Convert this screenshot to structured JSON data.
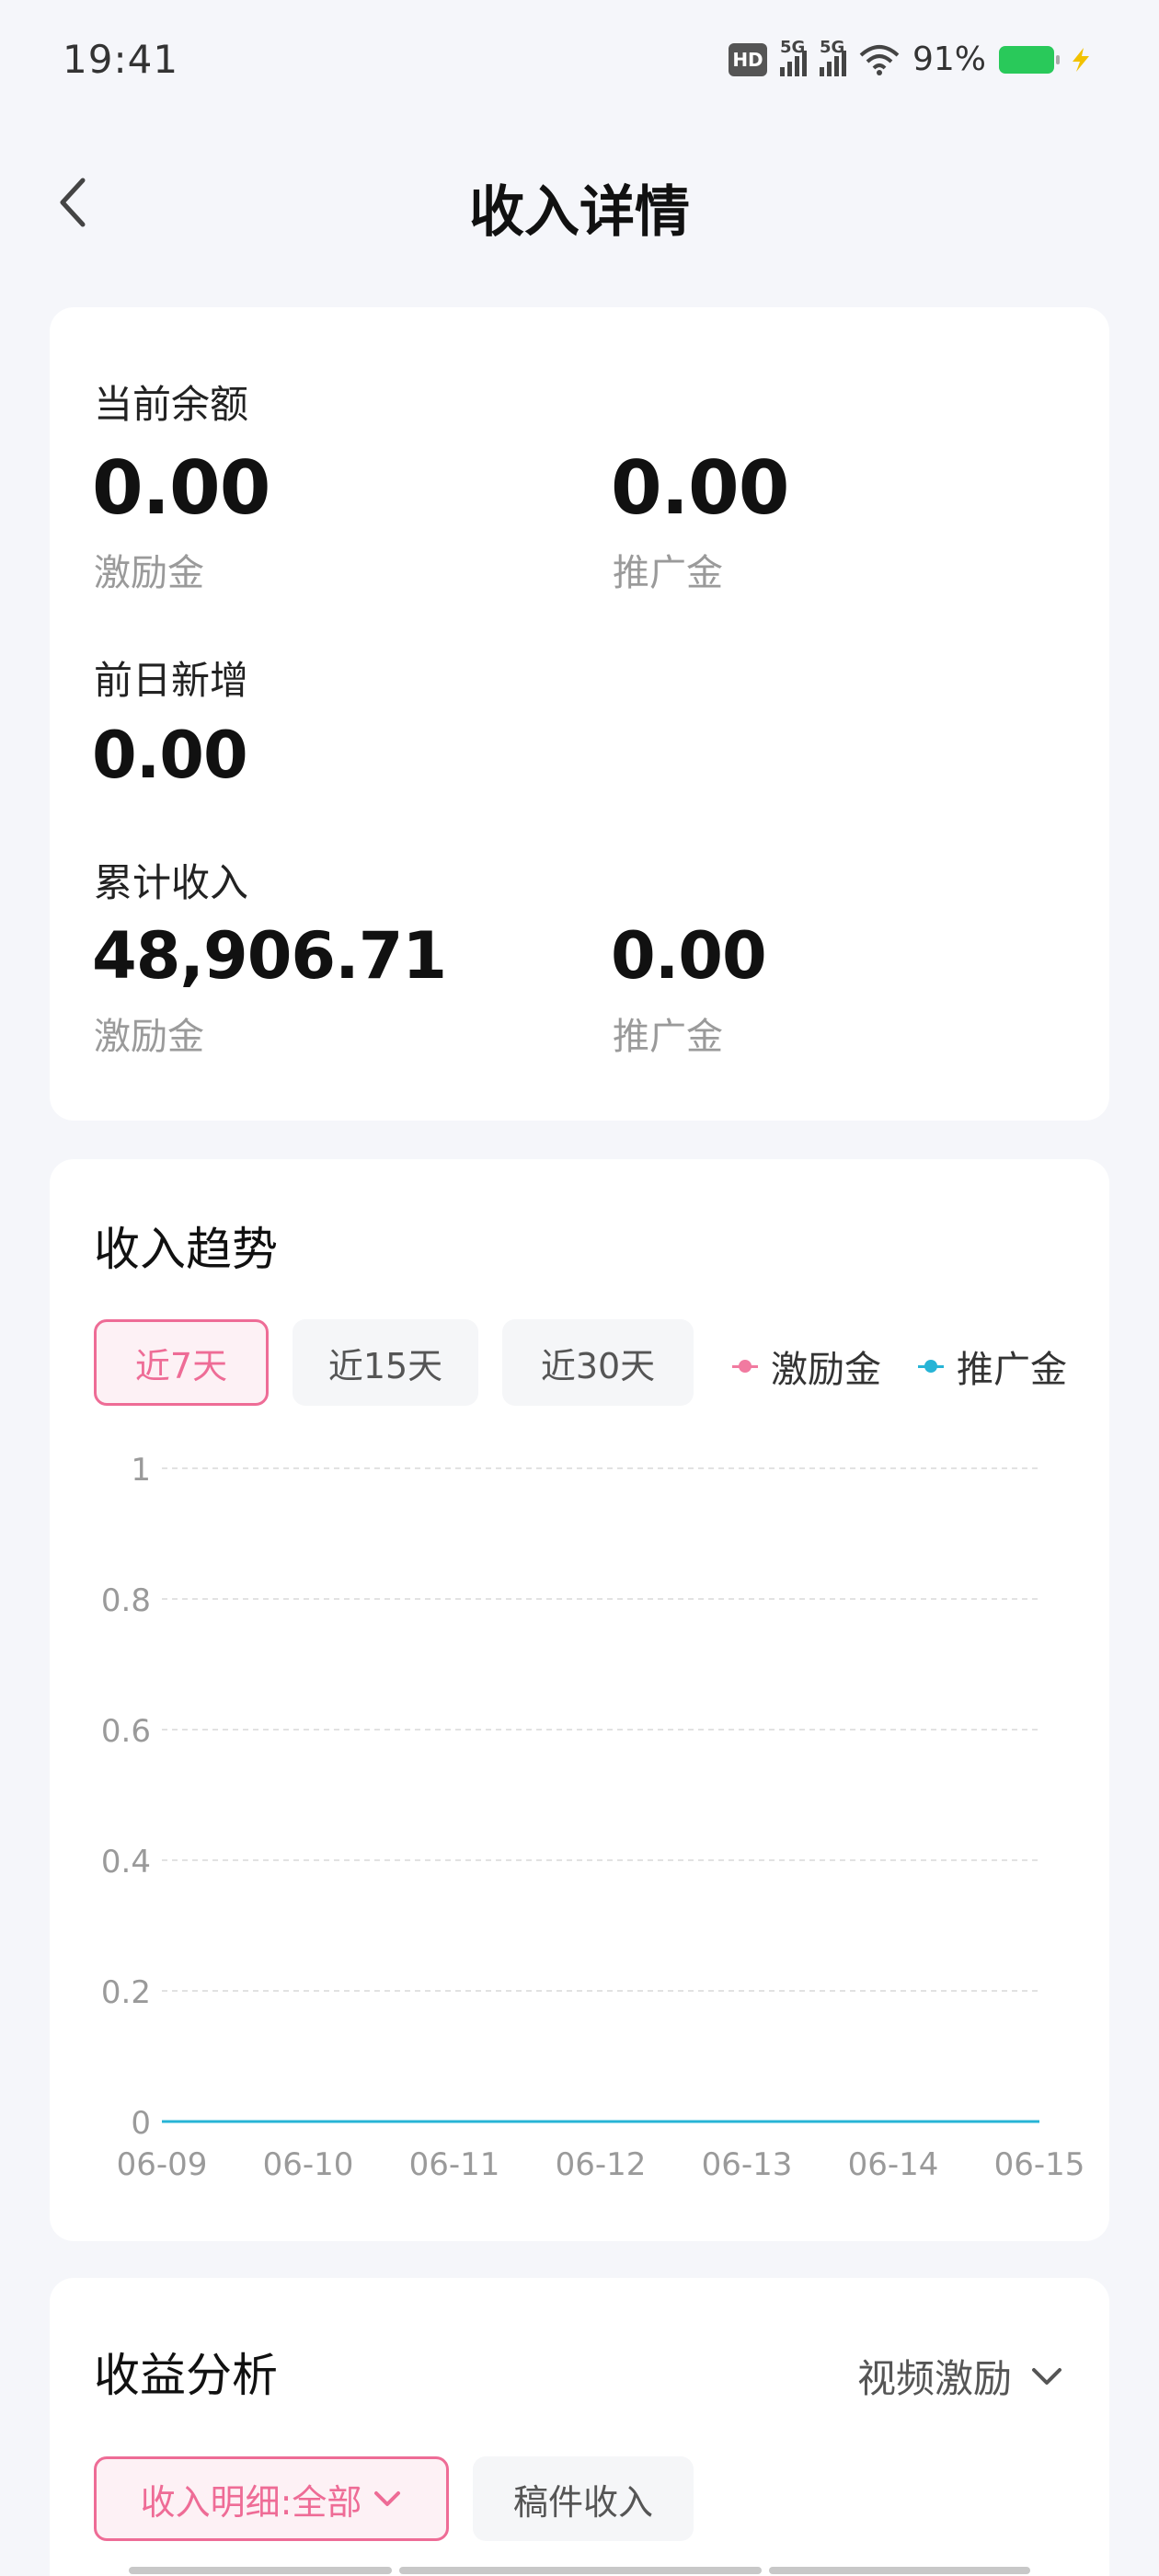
{
  "status_bar": {
    "time": "19:41",
    "hd_label": "HD",
    "sig1_label": "5G",
    "sig2_label": "5G",
    "battery_pct": "91%",
    "battery_color": "#29c95a"
  },
  "header": {
    "title": "收入详情",
    "back_icon": "chevron-left-icon"
  },
  "balance": {
    "current_label": "当前余额",
    "current_incentive_value": "0.00",
    "current_incentive_label": "激励金",
    "current_promo_value": "0.00",
    "current_promo_label": "推广金",
    "yesterday_label": "前日新增",
    "yesterday_value": "0.00",
    "total_label": "累计收入",
    "total_incentive_value": "48,906.71",
    "total_incentive_label": "激励金",
    "total_promo_value": "0.00",
    "total_promo_label": "推广金"
  },
  "trend": {
    "title": "收入趋势",
    "ranges": [
      {
        "label": "近7天",
        "active": true
      },
      {
        "label": "近15天",
        "active": false
      },
      {
        "label": "近30天",
        "active": false
      }
    ],
    "legend": [
      {
        "label": "激励金",
        "color": "#f17aa0"
      },
      {
        "label": "推广金",
        "color": "#27b4d6"
      }
    ]
  },
  "chart_data": {
    "type": "line",
    "title": "收入趋势",
    "categories": [
      "06-09",
      "06-10",
      "06-11",
      "06-12",
      "06-13",
      "06-14",
      "06-15"
    ],
    "series": [
      {
        "name": "激励金",
        "values": [
          0,
          0,
          0,
          0,
          0,
          0,
          0
        ],
        "color": "#f17aa0"
      },
      {
        "name": "推广金",
        "values": [
          0,
          0,
          0,
          0,
          0,
          0,
          0
        ],
        "color": "#27b4d6"
      }
    ],
    "yticks": [
      "0",
      "0.2",
      "0.4",
      "0.6",
      "0.8",
      "1"
    ],
    "ylim": [
      0,
      1
    ],
    "grid": true,
    "legend": "top-right"
  },
  "analysis": {
    "title": "收益分析",
    "type_select": "视频激励",
    "filter_active": "收入明细:全部",
    "filter_plain": "稿件收入",
    "accent": "#ee6c96"
  }
}
